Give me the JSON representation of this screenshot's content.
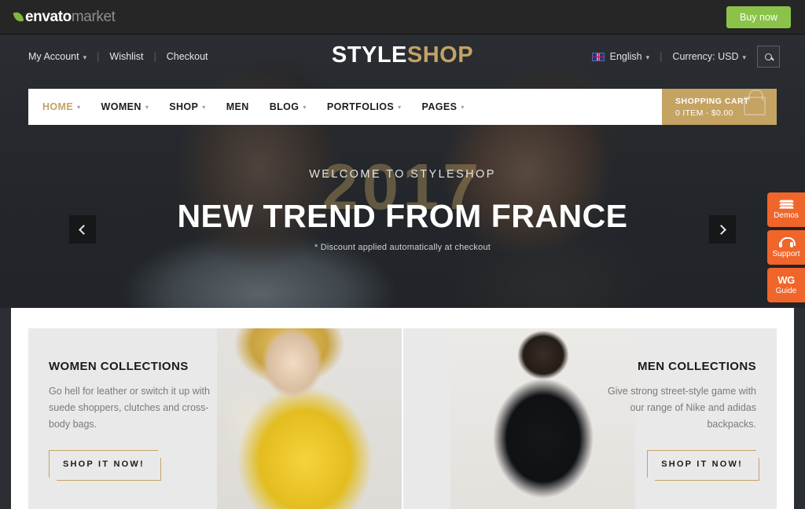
{
  "envato_bar": {
    "logo_primary": "envato",
    "logo_secondary": "market",
    "buy_now_label": "Buy now",
    "brand_green": "#8bc34a"
  },
  "header": {
    "utility_links": [
      {
        "label": "My Account",
        "has_caret": true
      },
      {
        "label": "Wishlist",
        "has_caret": false
      },
      {
        "label": "Checkout",
        "has_caret": false
      }
    ],
    "separator": "|",
    "brand": {
      "part1": "STYLE",
      "part2": "SHOP",
      "accent_color": "#c3a265"
    },
    "language": "English",
    "currency": "Currency: USD",
    "search_icon": "search-icon"
  },
  "nav": {
    "items": [
      {
        "label": "HOME",
        "caret": true,
        "active": true
      },
      {
        "label": "WOMEN",
        "caret": true,
        "active": false
      },
      {
        "label": "SHOP",
        "caret": true,
        "active": false
      },
      {
        "label": "MEN",
        "caret": false,
        "active": false
      },
      {
        "label": "BLOG",
        "caret": true,
        "active": false
      },
      {
        "label": "PORTFOLIOS",
        "caret": true,
        "active": false
      },
      {
        "label": "PAGES",
        "caret": true,
        "active": false
      }
    ],
    "cart": {
      "title": "SHOPPING CART",
      "summary": "0 ITEM - $0.00",
      "background": "#c4a363"
    }
  },
  "hero": {
    "year_watermark": "2017",
    "eyebrow": "WELCOME TO STYLESHOP",
    "headline": "NEW TREND FROM FRANCE",
    "note": "* Discount applied automatically at checkout",
    "prev_label": "‹",
    "next_label": "›"
  },
  "side_widgets": [
    {
      "label": "Demos",
      "icon": "layers-icon"
    },
    {
      "label": "Support",
      "icon": "headset-icon"
    },
    {
      "label": "Guide",
      "icon": "wg-logo-icon"
    }
  ],
  "collections": [
    {
      "title": "WOMEN COLLECTIONS",
      "description": "Go hell for leather or switch it up with suede shoppers, clutches and cross-body bags.",
      "button": "SHOP IT NOW!"
    },
    {
      "title": "MEN COLLECTIONS",
      "description": "Give strong street-style game with our range of Nike and adidas backpacks.",
      "button": "SHOP IT NOW!"
    }
  ]
}
